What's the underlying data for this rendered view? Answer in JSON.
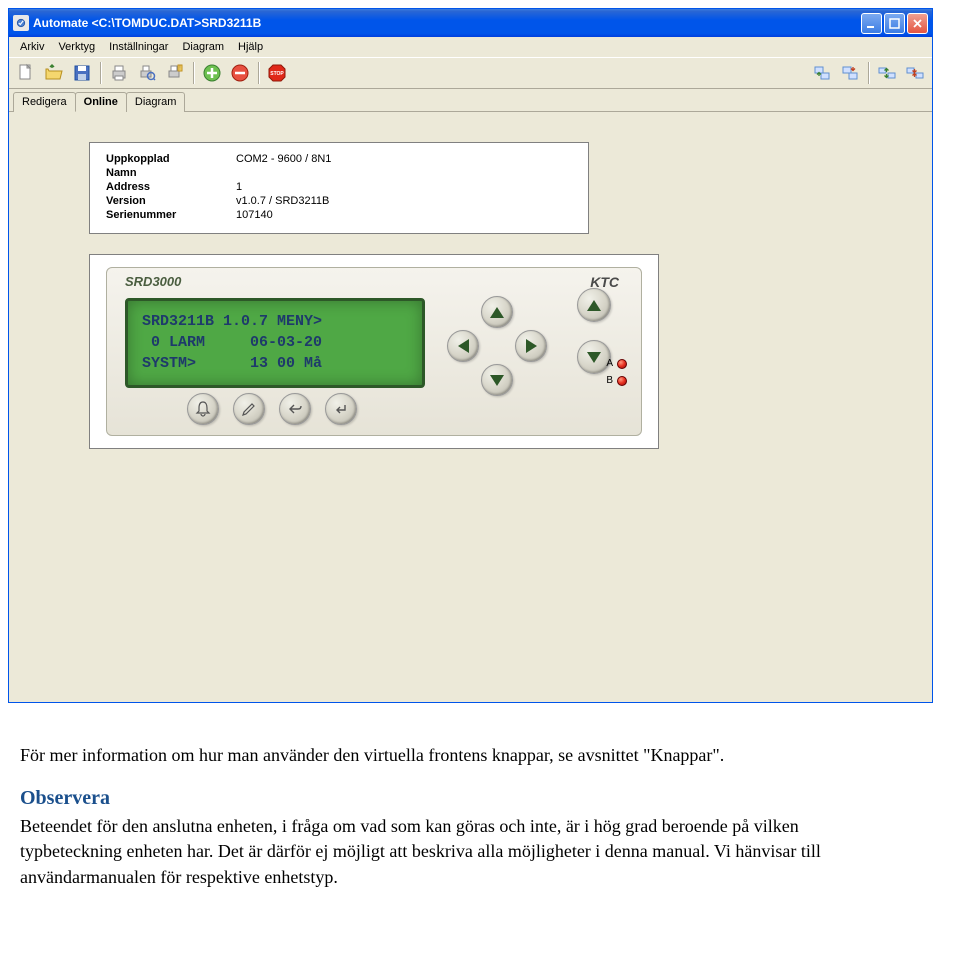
{
  "window": {
    "title": "Automate  <C:\\TOMDUC.DAT>SRD3211B"
  },
  "menubar": {
    "items": [
      "Arkiv",
      "Verktyg",
      "Inställningar",
      "Diagram",
      "Hjälp"
    ]
  },
  "tabs": {
    "items": [
      "Redigera",
      "Online",
      "Diagram"
    ],
    "activeIndex": 1
  },
  "info": {
    "rows": [
      {
        "label": "Uppkopplad",
        "value": "COM2 - 9600 / 8N1"
      },
      {
        "label": "Namn",
        "value": ""
      },
      {
        "label": "Address",
        "value": "1"
      },
      {
        "label": "Version",
        "value": "v1.0.7 / SRD3211B"
      },
      {
        "label": "Serienummer",
        "value": "107140"
      }
    ]
  },
  "device": {
    "model": "SRD3000",
    "brand": "KTC",
    "lcd": {
      "line1": "SRD3211B 1.0.7 MENY>",
      "line2": " 0 LARM     06-03-20",
      "line3": "SYSTM>      13 00 Må"
    },
    "leds": {
      "a": "A",
      "b": "B"
    }
  },
  "doc": {
    "p1": "För mer information om hur man använder den virtuella frontens knappar, se avsnittet \"Knappar\".",
    "heading": "Observera",
    "p2": "Beteendet för den anslutna enheten, i fråga om vad som kan göras och inte, är i hög grad beroende på vilken typbeteckning enheten har. Det är därför ej möjligt att beskriva alla möjligheter i denna manual. Vi hänvisar till användarmanualen för respektive enhetstyp."
  }
}
